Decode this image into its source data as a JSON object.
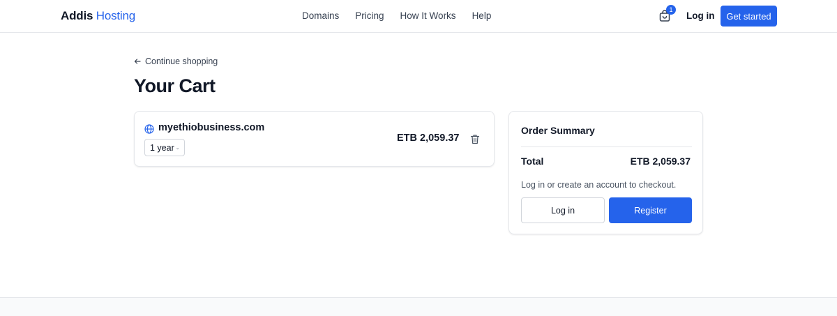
{
  "header": {
    "logo_part1": "Addis",
    "logo_part2": "Hosting",
    "nav": [
      "Domains",
      "Pricing",
      "How It Works",
      "Help"
    ],
    "cart_count": "1",
    "login_label": "Log in",
    "cta_label": "Get started"
  },
  "main": {
    "back_label": "Continue shopping",
    "title": "Your Cart"
  },
  "cart_item": {
    "icon": "globe-icon",
    "domain": "myethiobusiness.com",
    "period": "1 year",
    "price": "ETB 2,059.37",
    "remove_icon": "trash-icon"
  },
  "summary": {
    "title": "Order Summary",
    "total_label": "Total",
    "total_value": "ETB 2,059.37",
    "note": "Log in or create an account to checkout.",
    "login_label": "Log in",
    "register_label": "Register"
  },
  "colors": {
    "accent": "#2563eb",
    "text": "#111827",
    "border": "#e5e7eb"
  }
}
